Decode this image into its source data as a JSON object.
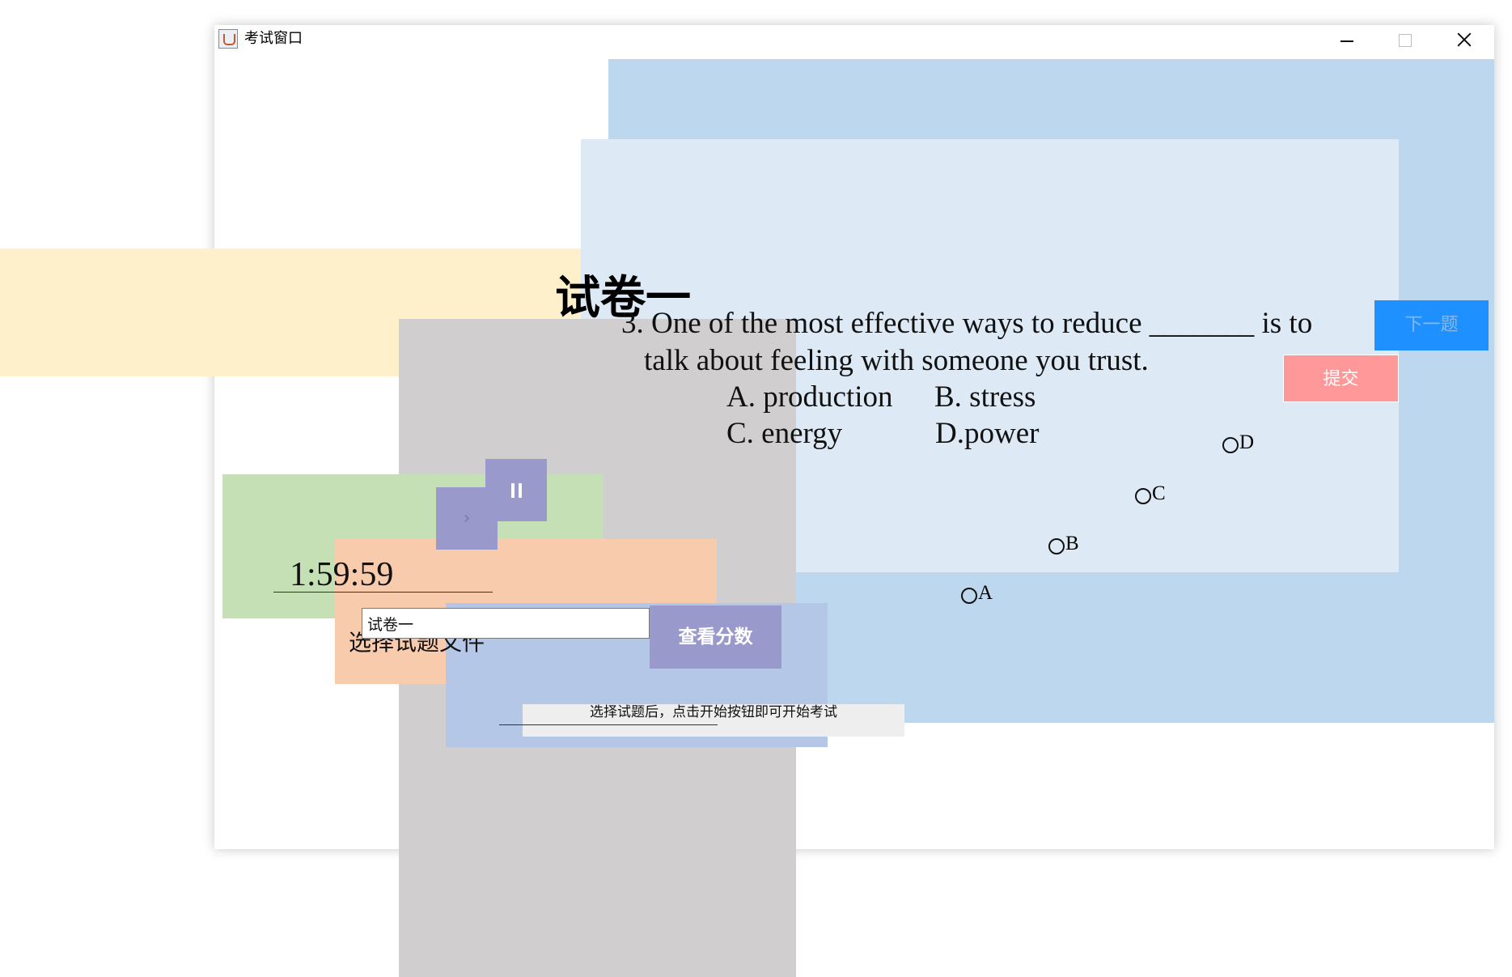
{
  "window": {
    "title": "考试窗口",
    "controls": [
      "minimize-icon",
      "maximize-icon",
      "close-icon"
    ]
  },
  "exam": {
    "paper_title": "试卷一",
    "question": {
      "line1": "3. One of the most effective ways to reduce _______ is to",
      "line2": "talk about feeling with someone you trust.",
      "options": {
        "a": "A. production",
        "b": "B. stress",
        "c": "C. energy",
        "d": "D.power"
      }
    },
    "answer_choices": {
      "a": "A",
      "b": "B",
      "c": "C",
      "d": "D"
    },
    "next_label": "下一题",
    "submit_label": "提交"
  },
  "timer": {
    "display": "1:59:59",
    "play_icon": "play-icon",
    "pause_icon": "pause-icon"
  },
  "file": {
    "label": "选择试题文件",
    "selected": "试卷一",
    "score_button_label": "查看分数"
  },
  "status": {
    "message": "选择试题后，点击开始按钮即可开始考试"
  },
  "colors": {
    "panel_blue": "#bdd7ee",
    "panel_light_blue": "#ddeaf6",
    "panel_yellow": "#fff0cc",
    "panel_gray": "#d0cece",
    "panel_green": "#c5e0b4",
    "panel_orange": "#f8cbad",
    "panel_periwinkle": "#b4c7e7",
    "next_button": "#1e90ff",
    "submit_button": "#ff9999",
    "control_button": "#9999cc"
  }
}
